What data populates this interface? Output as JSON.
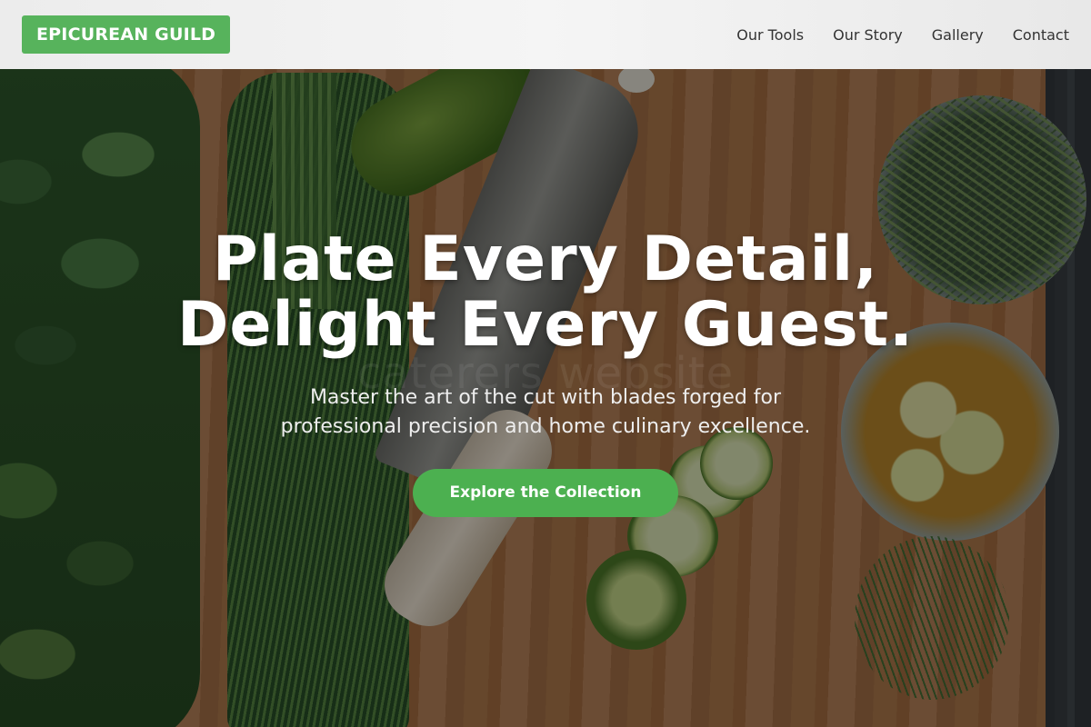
{
  "brand": {
    "logo_text": "EPICUREAN GUILD",
    "accent_color": "#4cb050"
  },
  "nav": {
    "items": [
      {
        "label": "Our Tools"
      },
      {
        "label": "Our Story"
      },
      {
        "label": "Gallery"
      },
      {
        "label": "Contact"
      }
    ]
  },
  "hero": {
    "title_line1": "Plate Every Detail,",
    "title_line2": "Delight Every Guest.",
    "subtitle_line1": "Master the art of the cut with blades forged for",
    "subtitle_line2": "professional precision and home culinary excellence.",
    "cta_label": "Explore the Collection",
    "watermark_text": "caterers website",
    "background_image": "kitchen-knife-herbs-cutting-board"
  }
}
